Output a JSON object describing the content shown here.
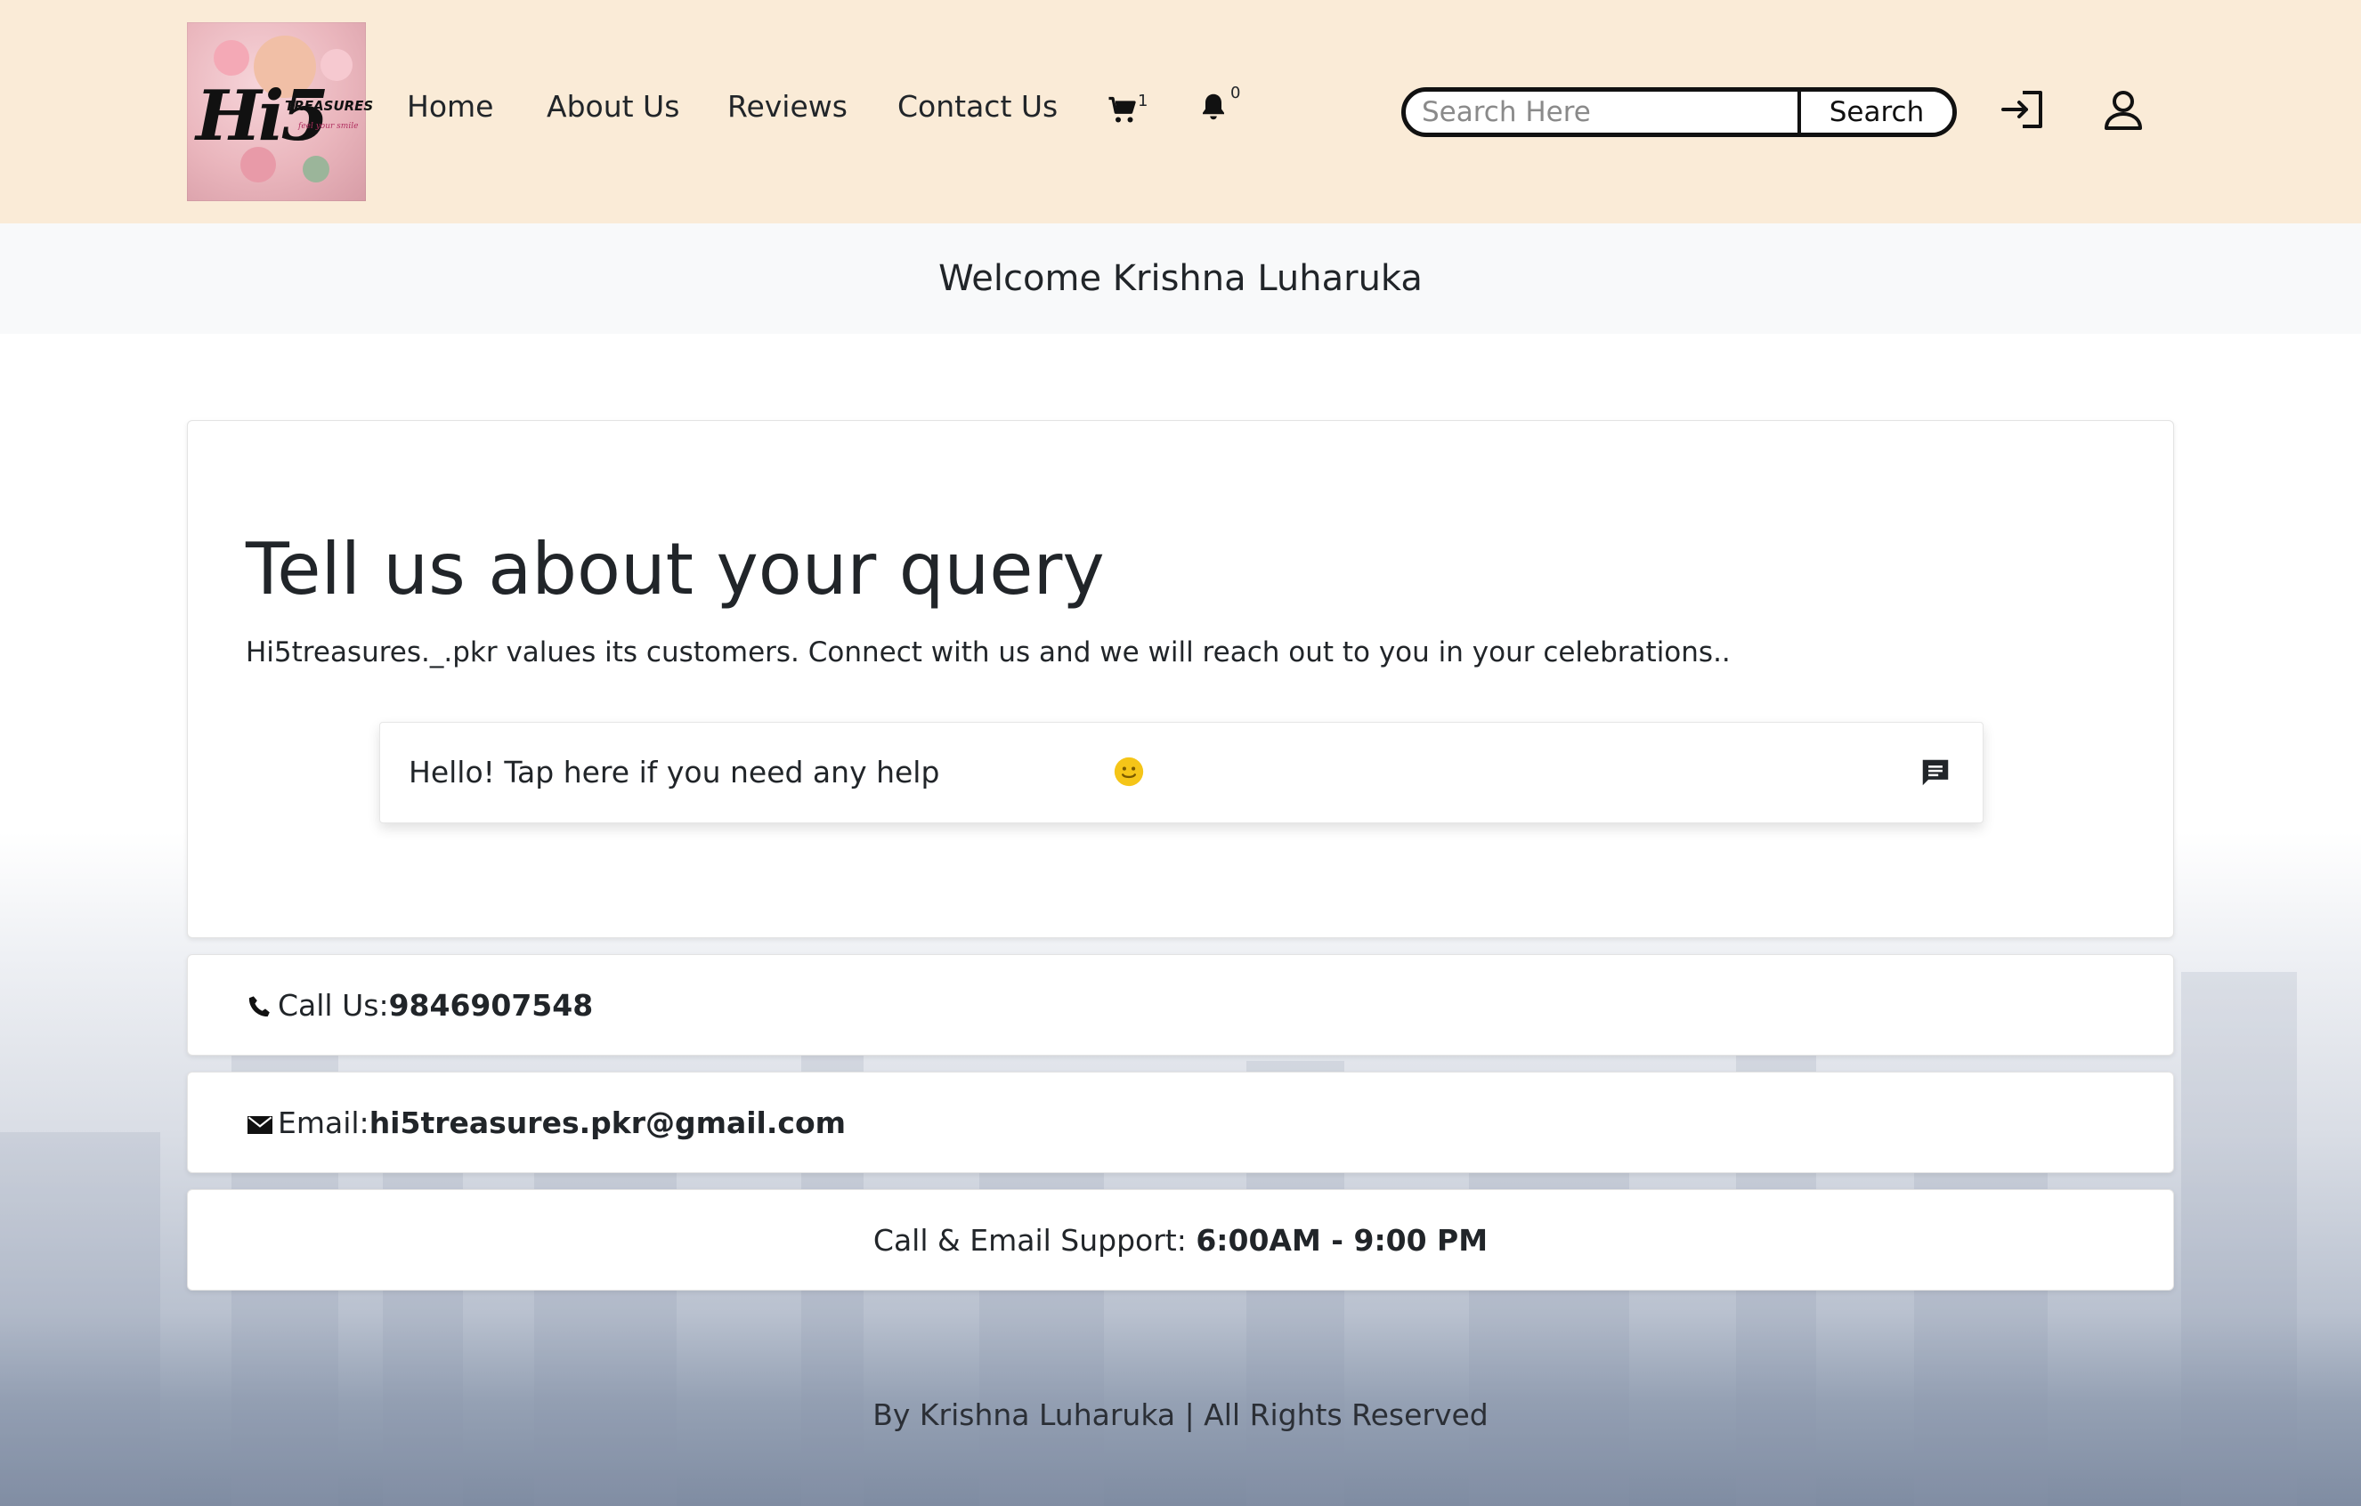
{
  "brand": {
    "logo_big": "Hi5",
    "logo_small": "TREASURES",
    "logo_tag": "feel your smile"
  },
  "nav": {
    "links": [
      {
        "label": "Home"
      },
      {
        "label": "About Us"
      },
      {
        "label": "Reviews"
      },
      {
        "label": "Contact Us"
      }
    ],
    "cart_count": "1",
    "notification_count": "0"
  },
  "search": {
    "placeholder": "Search Here",
    "button_label": "Search"
  },
  "welcome": {
    "text": "Welcome Krishna Luharuka"
  },
  "main": {
    "title": "Tell us about your query",
    "subtitle": "Hi5treasures._.pkr values its customers. Connect with us and we will reach out to you in your celebrations..",
    "chat_prompt": "Hello! Tap here if you need any help"
  },
  "contact": {
    "call_label": "Call Us:",
    "call_number": "9846907548",
    "email_label": "Email:",
    "email_value": "hi5treasures.pkr@gmail.com",
    "support_label": "Call & Email Support: ",
    "support_hours": "6:00AM - 9:00 PM"
  },
  "footer": {
    "text": "By Krishna Luharuka | All Rights Reserved"
  },
  "colors": {
    "navbar_bg": "#faebd7",
    "welcome_bg": "#f8f9fa",
    "text": "#212529",
    "smile": "#f5c518"
  },
  "icons": {
    "cart": "shopping-cart-icon",
    "bell": "bell-icon",
    "login": "login-icon",
    "user": "user-icon",
    "chat": "chat-icon",
    "phone": "phone-icon",
    "mail": "envelope-icon",
    "smile": "smiley-icon"
  }
}
